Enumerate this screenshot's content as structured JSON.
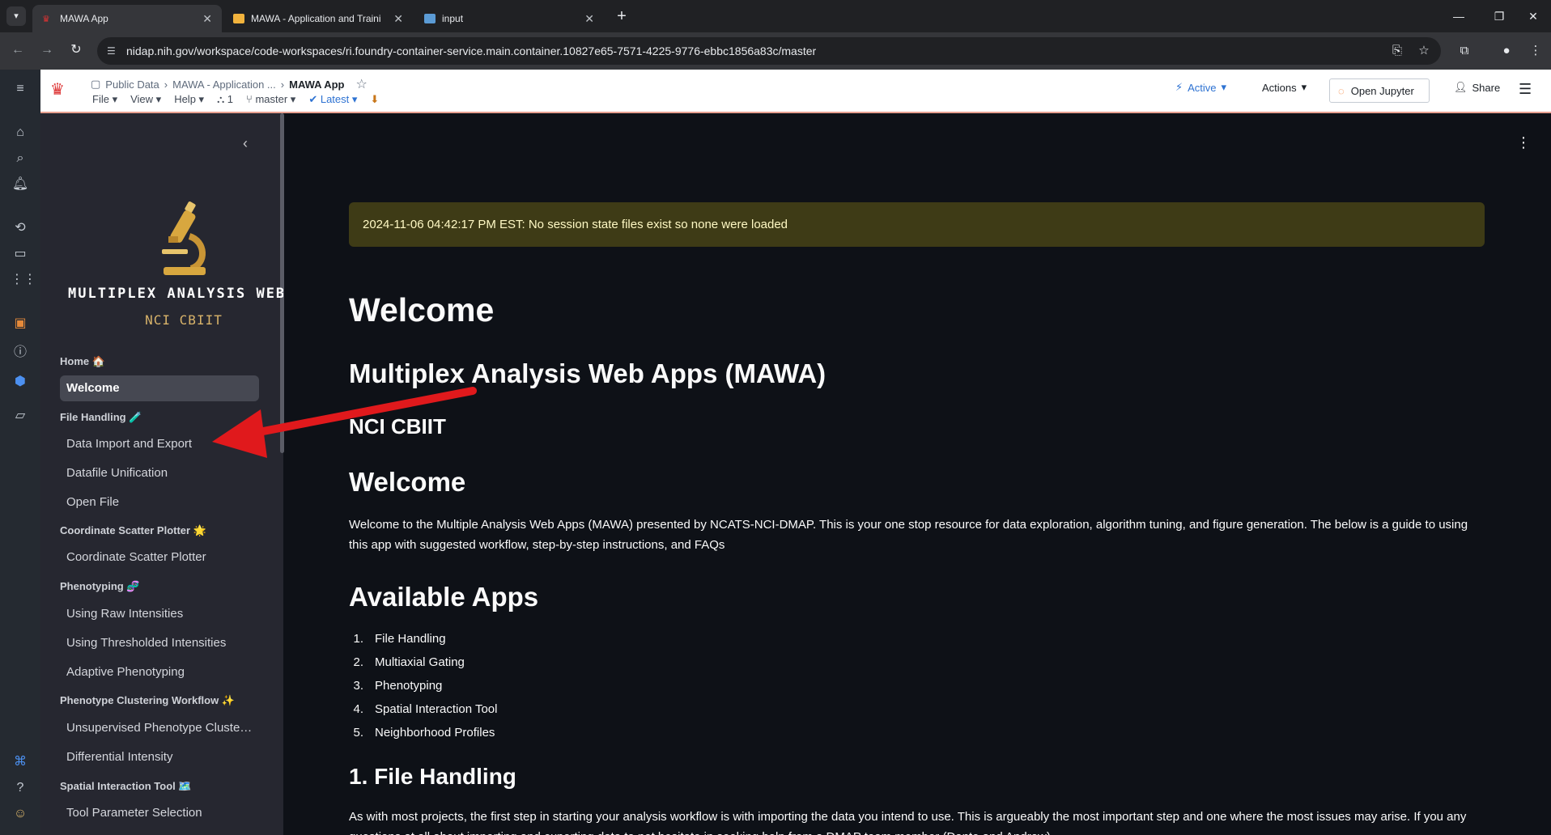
{
  "browser": {
    "tabs": [
      {
        "title": "MAWA App",
        "active": true
      },
      {
        "title": "MAWA - Application and Traini",
        "active": false
      },
      {
        "title": "input",
        "active": false
      }
    ],
    "url": "nidap.nih.gov/workspace/code-workspaces/ri.foundry-container-service.main.container.10827e65-7571-4225-9776-ebbc1856a83c/master"
  },
  "app_header": {
    "breadcrumb": [
      "Public Data",
      "MAWA - Application ..."
    ],
    "current": "MAWA App",
    "menus": [
      "File",
      "View",
      "Help"
    ],
    "count": "1",
    "branch": "master",
    "version": "Latest",
    "status": "Active",
    "actions_label": "Actions",
    "open_jupyter_label": "Open Jupyter",
    "share_label": "Share"
  },
  "sidebar": {
    "brand_title": "MULTIPLEX ANALYSIS WEB APPS",
    "brand_subtitle": "NCI CBIIT",
    "sections": [
      {
        "header": "Home 🏠",
        "items": [
          "Welcome"
        ]
      },
      {
        "header": "File Handling 🧪",
        "items": [
          "Data Import and Export",
          "Datafile Unification",
          "Open File"
        ]
      },
      {
        "header": "Coordinate Scatter Plotter 🌟",
        "items": [
          "Coordinate Scatter Plotter"
        ]
      },
      {
        "header": "Phenotyping 🧬",
        "items": [
          "Using Raw Intensities",
          "Using Thresholded Intensities",
          "Adaptive Phenotyping"
        ]
      },
      {
        "header": "Phenotype Clustering Workflow ✨",
        "items": [
          "Unsupervised Phenotype Cluste…",
          "Differential Intensity"
        ]
      },
      {
        "header": "Spatial Interaction Tool 🗺️",
        "items": [
          "Tool Parameter Selection"
        ]
      }
    ],
    "selected": "Welcome"
  },
  "main": {
    "alert": "2024-11-06 04:42:17 PM EST: No session state files exist so none were loaded",
    "title": "Welcome",
    "subtitle": "Multiplex Analysis Web Apps (MAWA)",
    "org": "NCI CBIIT",
    "welcome_heading": "Welcome",
    "welcome_text": "Welcome to the Multiple Analysis Web Apps (MAWA) presented by NCATS-NCI-DMAP. This is your one stop resource for data exploration, algorithm tuning, and figure generation. The below is a guide to using this app with suggested workflow, step-by-step instructions, and FAQs",
    "apps_heading": "Available Apps",
    "apps": [
      "File Handling",
      "Multiaxial Gating",
      "Phenotyping",
      "Spatial Interaction Tool",
      "Neighborhood Profiles"
    ],
    "section1_heading": "1. File Handling",
    "section1_text": "As with most projects, the first step in starting your analysis workflow is with importing the data you intend to use. This is argueably the most important step and one where the most issues may arise. If you any questions at all about importing and exporting data to not hesitate in seeking help from a DMAP team member (Dante and Andrew)."
  },
  "colors": {
    "accent_red_arrow": "#e0191c",
    "alert_bg": "#3e3b16",
    "sidebar_bg": "#262730",
    "main_bg": "#0e1117",
    "brand_gold": "#d8b36a"
  }
}
